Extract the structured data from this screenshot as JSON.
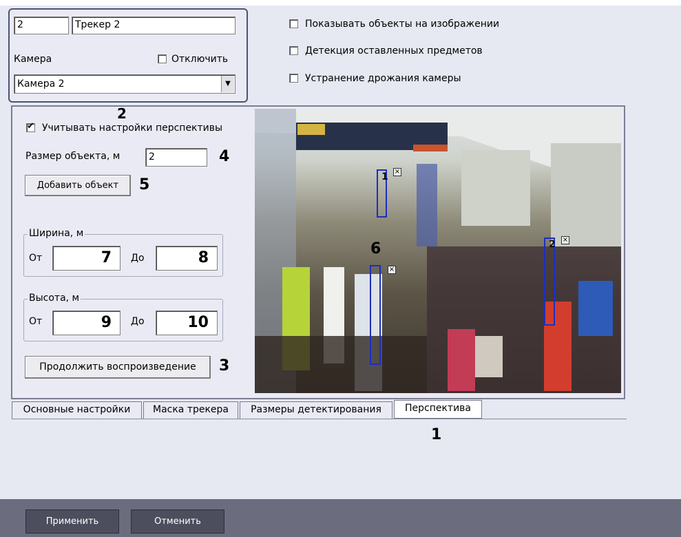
{
  "top_group": {
    "id_value": "2",
    "name_value": "Трекер 2",
    "camera_label": "Камера",
    "disable_label": "Отключить",
    "camera_select_value": "Камера 2"
  },
  "options": {
    "show_objects_label": "Показывать объекты на изображении",
    "left_objects_label": "Детекция оставленных предметов",
    "stabilization_label": "Устранение дрожания камеры"
  },
  "perspective": {
    "use_perspective_label": "Учитывать настройки перспективы",
    "use_perspective_checked": true,
    "object_size_label": "Размер объекта, м",
    "object_size_value": "2",
    "add_object_button": "Добавить объект",
    "width_group_label": "Ширина, м",
    "width_from_label": "От",
    "width_from_value": "7",
    "width_to_label": "До",
    "width_to_value": "8",
    "height_group_label": "Высота, м",
    "height_from_label": "От",
    "height_from_value": "9",
    "height_to_label": "До",
    "height_to_value": "10",
    "continue_button": "Продолжить воспроизведение"
  },
  "callouts": {
    "n1": "1",
    "n2": "2",
    "n3": "3",
    "n4": "4",
    "n5": "5",
    "n6": "6"
  },
  "video": {
    "box_labels": [
      "1",
      "2"
    ],
    "close_glyph": "×"
  },
  "tabs": [
    "Основные настройки",
    "Маска трекера",
    "Размеры детектирования",
    "Перспектива"
  ],
  "active_tab": "Перспектива",
  "footer": {
    "apply_button": "Применить",
    "cancel_button": "Отменить"
  }
}
